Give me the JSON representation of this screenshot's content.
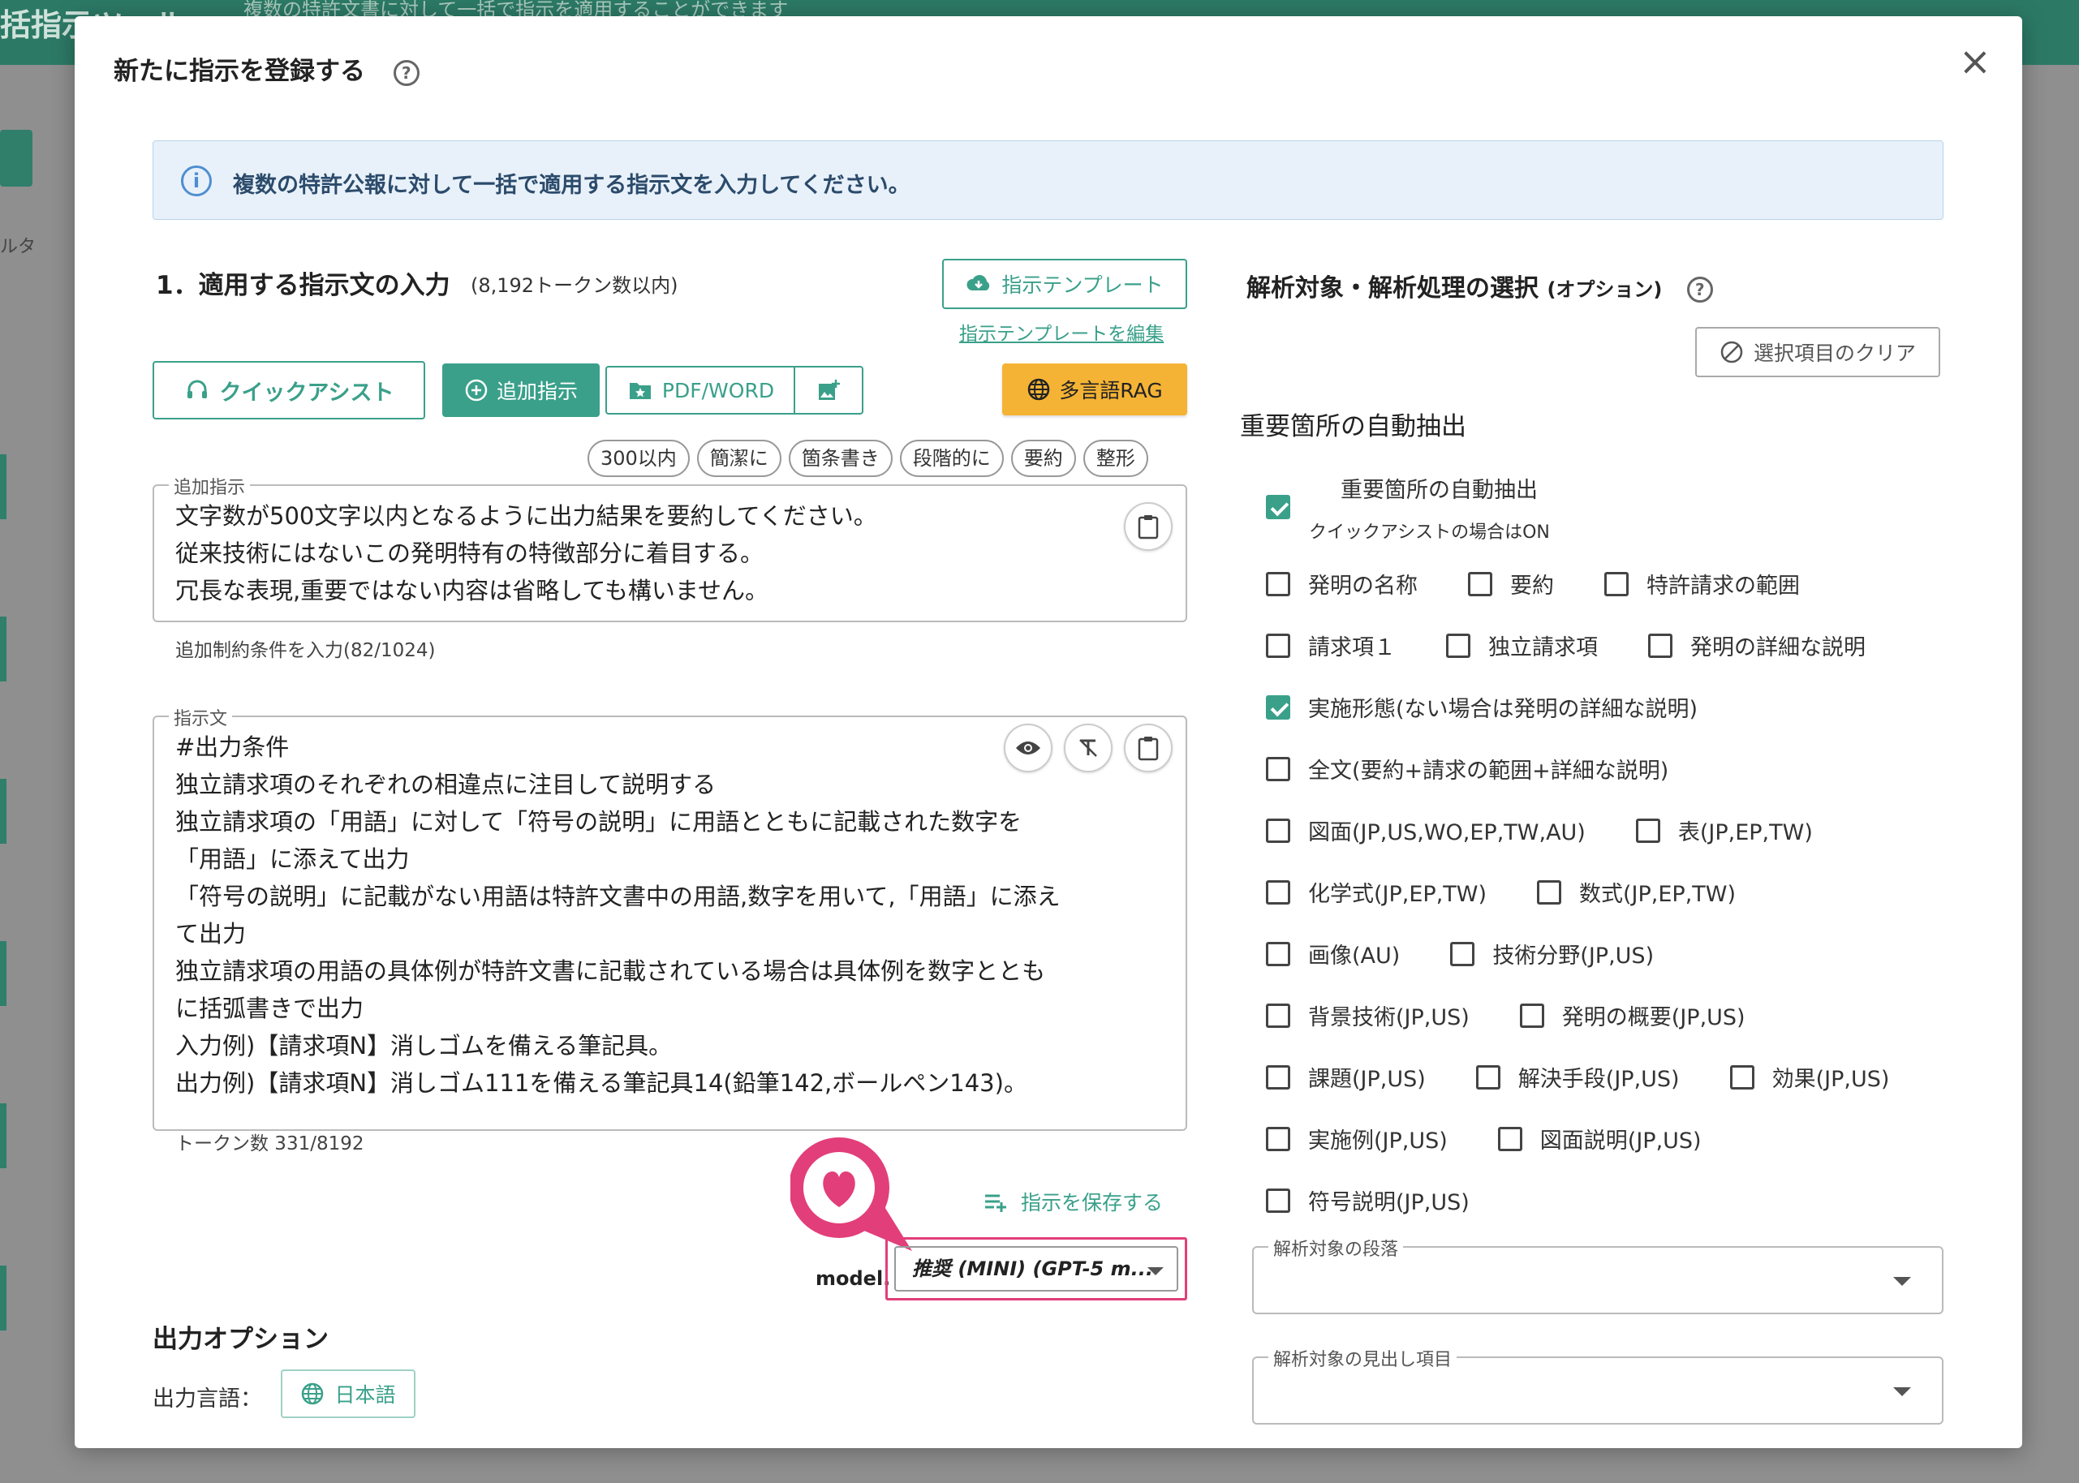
{
  "background": {
    "title": "括指示ツール",
    "subtitle": "複数の特許文書に対して一括で指示を適用することができます",
    "filter_label": "ルタ"
  },
  "modal": {
    "title": "新たに指示を登録する",
    "close": "×",
    "info": "複数の特許公報に対して一括で適用する指示文を入力してください。"
  },
  "section1": {
    "title": "1．適用する指示文の入力",
    "subtitle": "(8,192トークン数以内)",
    "template_button": "指示テンプレート",
    "template_edit": "指示テンプレートを編集",
    "quick_assist": "クイックアシスト",
    "add_instruction": "追加指示",
    "pdf_word": "PDF/WORD",
    "rag": "多言語RAG",
    "chips": [
      "300以内",
      "簡潔に",
      "箇条書き",
      "段階的に",
      "要約",
      "整形"
    ],
    "add_field": {
      "legend": "追加指示",
      "lines": [
        "文字数が500文字以内となるように出力結果を要約してください。",
        "従来技術にはないこの発明特有の特徴部分に着目する。",
        "冗長な表現,重要ではない内容は省略しても構いません。"
      ],
      "helper": "追加制約条件を入力(82/1024)"
    },
    "instruction_field": {
      "legend": "指示文",
      "lines": [
        "#出力条件",
        "独立請求項のそれぞれの相違点に注目して説明する",
        "独立請求項の「用語」に対して「符号の説明」に用語とともに記載された数字を",
        "「用語」に添えて出力",
        "「符号の説明」に記載がない用語は特許文書中の用語,数字を用いて,「用語」に添え",
        "て出力",
        "独立請求項の用語の具体例が特許文書に記載されている場合は具体例を数字ととも",
        "に括弧書きで出力",
        "入力例)【請求項N】消しゴムを備える筆記具。",
        "出力例)【請求項N】消しゴム111を備える筆記具14(鉛筆142,ボールペン143)。"
      ],
      "helper": "トークン数 331/8192"
    },
    "save": "指示を保存する",
    "model_label": "model.",
    "model_value": "推奨 (MINI) (GPT-5 m..."
  },
  "output": {
    "title": "出力オプション",
    "lang_label": "出力言語：",
    "lang_value": "日本語"
  },
  "right": {
    "title": "解析対象・解析処理の選択",
    "title_suffix": "(オプション)",
    "clear": "選択項目のクリア",
    "subtitle": "重要箇所の自動抽出",
    "auto_extract": {
      "label": "重要箇所の自動抽出",
      "note": "クイックアシストの場合はON",
      "checked": true
    },
    "checkbox_rows": [
      [
        {
          "label": "発明の名称",
          "checked": false
        },
        {
          "label": "要約",
          "checked": false
        },
        {
          "label": "特許請求の範囲",
          "checked": false
        }
      ],
      [
        {
          "label": "請求項１",
          "checked": false
        },
        {
          "label": "独立請求項",
          "checked": false
        },
        {
          "label": "発明の詳細な説明",
          "checked": false
        }
      ],
      [
        {
          "label": "実施形態(ない場合は発明の詳細な説明)",
          "checked": true
        }
      ],
      [
        {
          "label": "全文(要約+請求の範囲+詳細な説明)",
          "checked": false
        }
      ],
      [
        {
          "label": "図面(JP,US,WO,EP,TW,AU)",
          "checked": false
        },
        {
          "label": "表(JP,EP,TW)",
          "checked": false
        }
      ],
      [
        {
          "label": "化学式(JP,EP,TW)",
          "checked": false
        },
        {
          "label": "数式(JP,EP,TW)",
          "checked": false
        }
      ],
      [
        {
          "label": "画像(AU)",
          "checked": false
        },
        {
          "label": "技術分野(JP,US)",
          "checked": false
        }
      ],
      [
        {
          "label": "背景技術(JP,US)",
          "checked": false
        },
        {
          "label": "発明の概要(JP,US)",
          "checked": false
        }
      ],
      [
        {
          "label": "課題(JP,US)",
          "checked": false
        },
        {
          "label": "解決手段(JP,US)",
          "checked": false
        },
        {
          "label": "効果(JP,US)",
          "checked": false
        }
      ],
      [
        {
          "label": "実施例(JP,US)",
          "checked": false
        },
        {
          "label": "図面説明(JP,US)",
          "checked": false
        }
      ],
      [
        {
          "label": "符号説明(JP,US)",
          "checked": false
        }
      ]
    ],
    "paragraph_select": "解析対象の段落",
    "heading_select": "解析対象の見出し項目"
  },
  "colors": {
    "accent": "#3aa08a",
    "highlight": "#e23e7a",
    "rag": "#f5b335"
  }
}
